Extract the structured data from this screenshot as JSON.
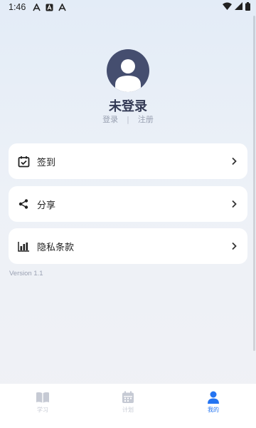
{
  "status_bar": {
    "time": "1:46",
    "notification_icons": [
      "a-font-icon",
      "a-box-icon",
      "a-font-icon"
    ],
    "right_icons": [
      "wifi-icon",
      "signal-icon",
      "battery-icon"
    ]
  },
  "profile": {
    "name": "未登录",
    "login_label": "登录",
    "divider": "|",
    "register_label": "注册"
  },
  "menu": [
    {
      "label": "签到",
      "icon": "calendar-check-icon"
    },
    {
      "label": "分享",
      "icon": "share-icon"
    },
    {
      "label": "隐私条款",
      "icon": "bar-chart-icon"
    }
  ],
  "version": "Version 1.1",
  "tabs": [
    {
      "label": "学习",
      "icon": "book-icon",
      "active": false
    },
    {
      "label": "计划",
      "icon": "calendar-icon",
      "active": false
    },
    {
      "label": "我的",
      "icon": "person-icon",
      "active": true
    }
  ],
  "colors": {
    "accent": "#2474f1",
    "avatar_bg": "#454e6f",
    "inactive_tab": "#c6cad4",
    "title": "#333a55"
  }
}
